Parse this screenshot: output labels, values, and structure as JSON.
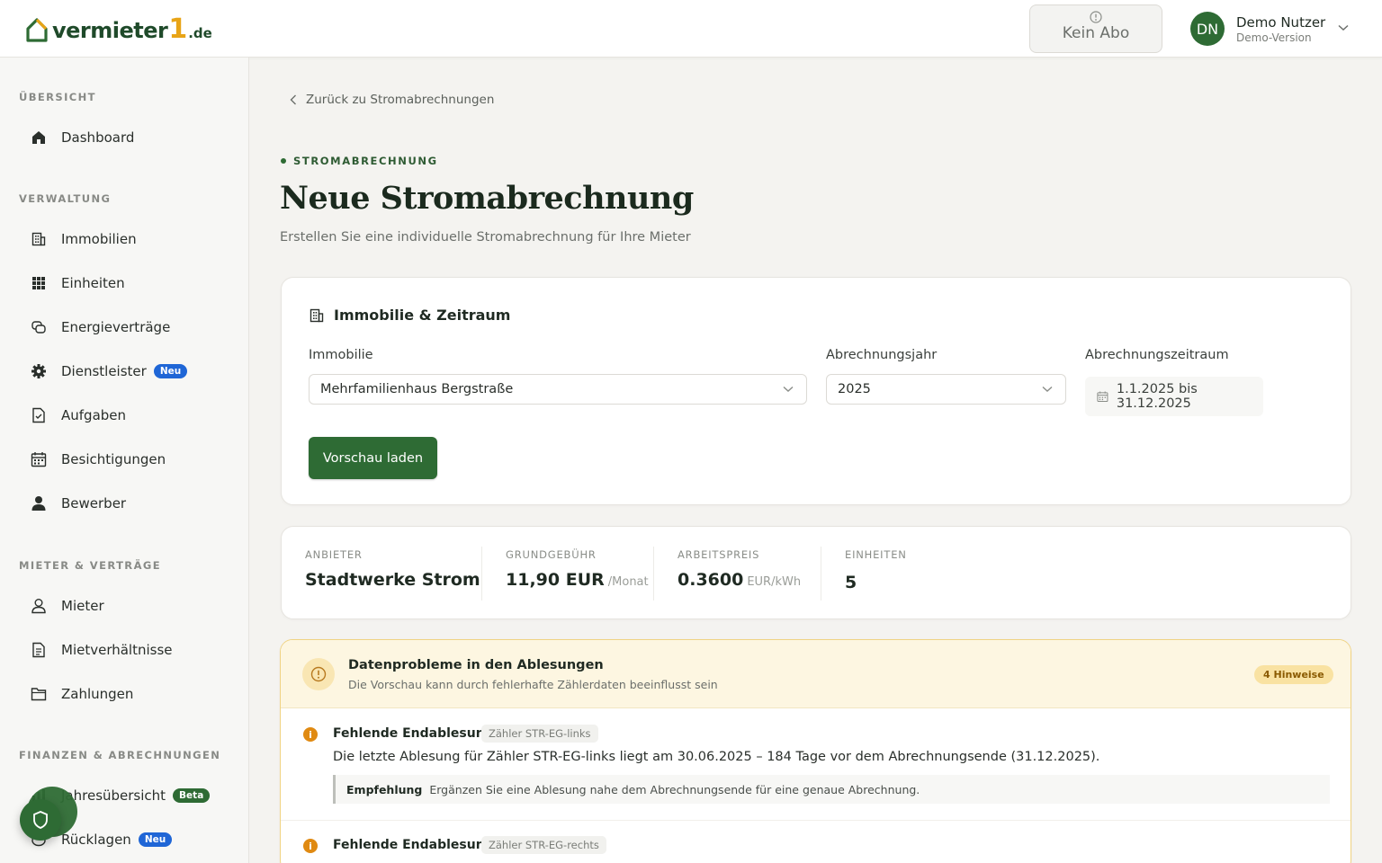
{
  "header": {
    "logo_text": "vermieter",
    "logo_number": "1",
    "logo_domain": ".de",
    "subscription_label": "Kein Abo",
    "user": {
      "initials": "DN",
      "name": "Demo Nutzer",
      "subtitle": "Demo-Version"
    }
  },
  "sidebar": {
    "sections": [
      {
        "title": "ÜBERSICHT",
        "items": [
          {
            "label": "Dashboard",
            "icon": "home-icon"
          }
        ]
      },
      {
        "title": "VERWALTUNG",
        "items": [
          {
            "label": "Immobilien",
            "icon": "building-icon"
          },
          {
            "label": "Einheiten",
            "icon": "grid-icon"
          },
          {
            "label": "Energieverträge",
            "icon": "contract-icon"
          },
          {
            "label": "Dienstleister",
            "icon": "gear-icon",
            "badge": "Neu"
          },
          {
            "label": "Aufgaben",
            "icon": "task-icon"
          },
          {
            "label": "Besichtigungen",
            "icon": "calendar-icon"
          },
          {
            "label": "Bewerber",
            "icon": "person-icon"
          }
        ]
      },
      {
        "title": "MIETER & VERTRÄGE",
        "items": [
          {
            "label": "Mieter",
            "icon": "user-icon"
          },
          {
            "label": "Mietverhältnisse",
            "icon": "document-icon"
          },
          {
            "label": "Zahlungen",
            "icon": "folder-icon"
          }
        ]
      },
      {
        "title": "FINANZEN & ABRECHNUNGEN",
        "items": [
          {
            "label": "Jahresübersicht",
            "icon": "chart-icon",
            "badge": "Beta"
          },
          {
            "label": "Rücklagen",
            "icon": "piggy-icon",
            "badge": "Neu"
          }
        ]
      }
    ]
  },
  "page": {
    "back_link": "Zurück zu Stromabrechnungen",
    "eyebrow": "STROMABRECHNUNG",
    "title": "Neue Stromabrechnung",
    "subtitle": "Erstellen Sie eine individuelle Stromabrechnung für Ihre Mieter"
  },
  "form": {
    "heading": "Immobilie & Zeitraum",
    "property_label": "Immobilie",
    "property_value": "Mehrfamilienhaus Bergstraße",
    "year_label": "Abrechnungsjahr",
    "year_value": "2025",
    "period_label": "Abrechnungszeitraum",
    "period_value": "1.1.2025 bis 31.12.2025",
    "preview_button": "Vorschau laden"
  },
  "stats": {
    "provider_label": "ANBIETER",
    "provider_value": "Stadtwerke Strom",
    "base_fee_label": "GRUNDGEBÜHR",
    "base_fee_value": "11,90 EUR",
    "base_fee_unit": "/Monat",
    "price_label": "ARBEITSPREIS",
    "price_value": "0.3600",
    "price_unit": "EUR/kWh",
    "units_label": "EINHEITEN",
    "units_value": "5"
  },
  "warnings": {
    "title": "Datenprobleme in den Ablesungen",
    "subtitle": "Die Vorschau kann durch fehlerhafte Zählerdaten beeinflusst sein",
    "count_badge": "4 Hinweise",
    "items": [
      {
        "title": "Fehlende Endablesung",
        "meter": "Zähler STR-EG-links",
        "text": "Die letzte Ablesung für Zähler STR-EG-links liegt am 30.06.2025 – 184 Tage vor dem Abrechnungsende (31.12.2025).",
        "recommendation_label": "Empfehlung",
        "recommendation": "Ergänzen Sie eine Ablesung nahe dem Abrechnungsende für eine genaue Abrechnung."
      },
      {
        "title": "Fehlende Endablesung",
        "meter": "Zähler STR-EG-rechts"
      }
    ]
  },
  "colors": {
    "primary": "#2e6b34",
    "accent": "#e8a417",
    "warning_bg": "#fdf6e1",
    "badge_blue": "#1f66d6"
  }
}
